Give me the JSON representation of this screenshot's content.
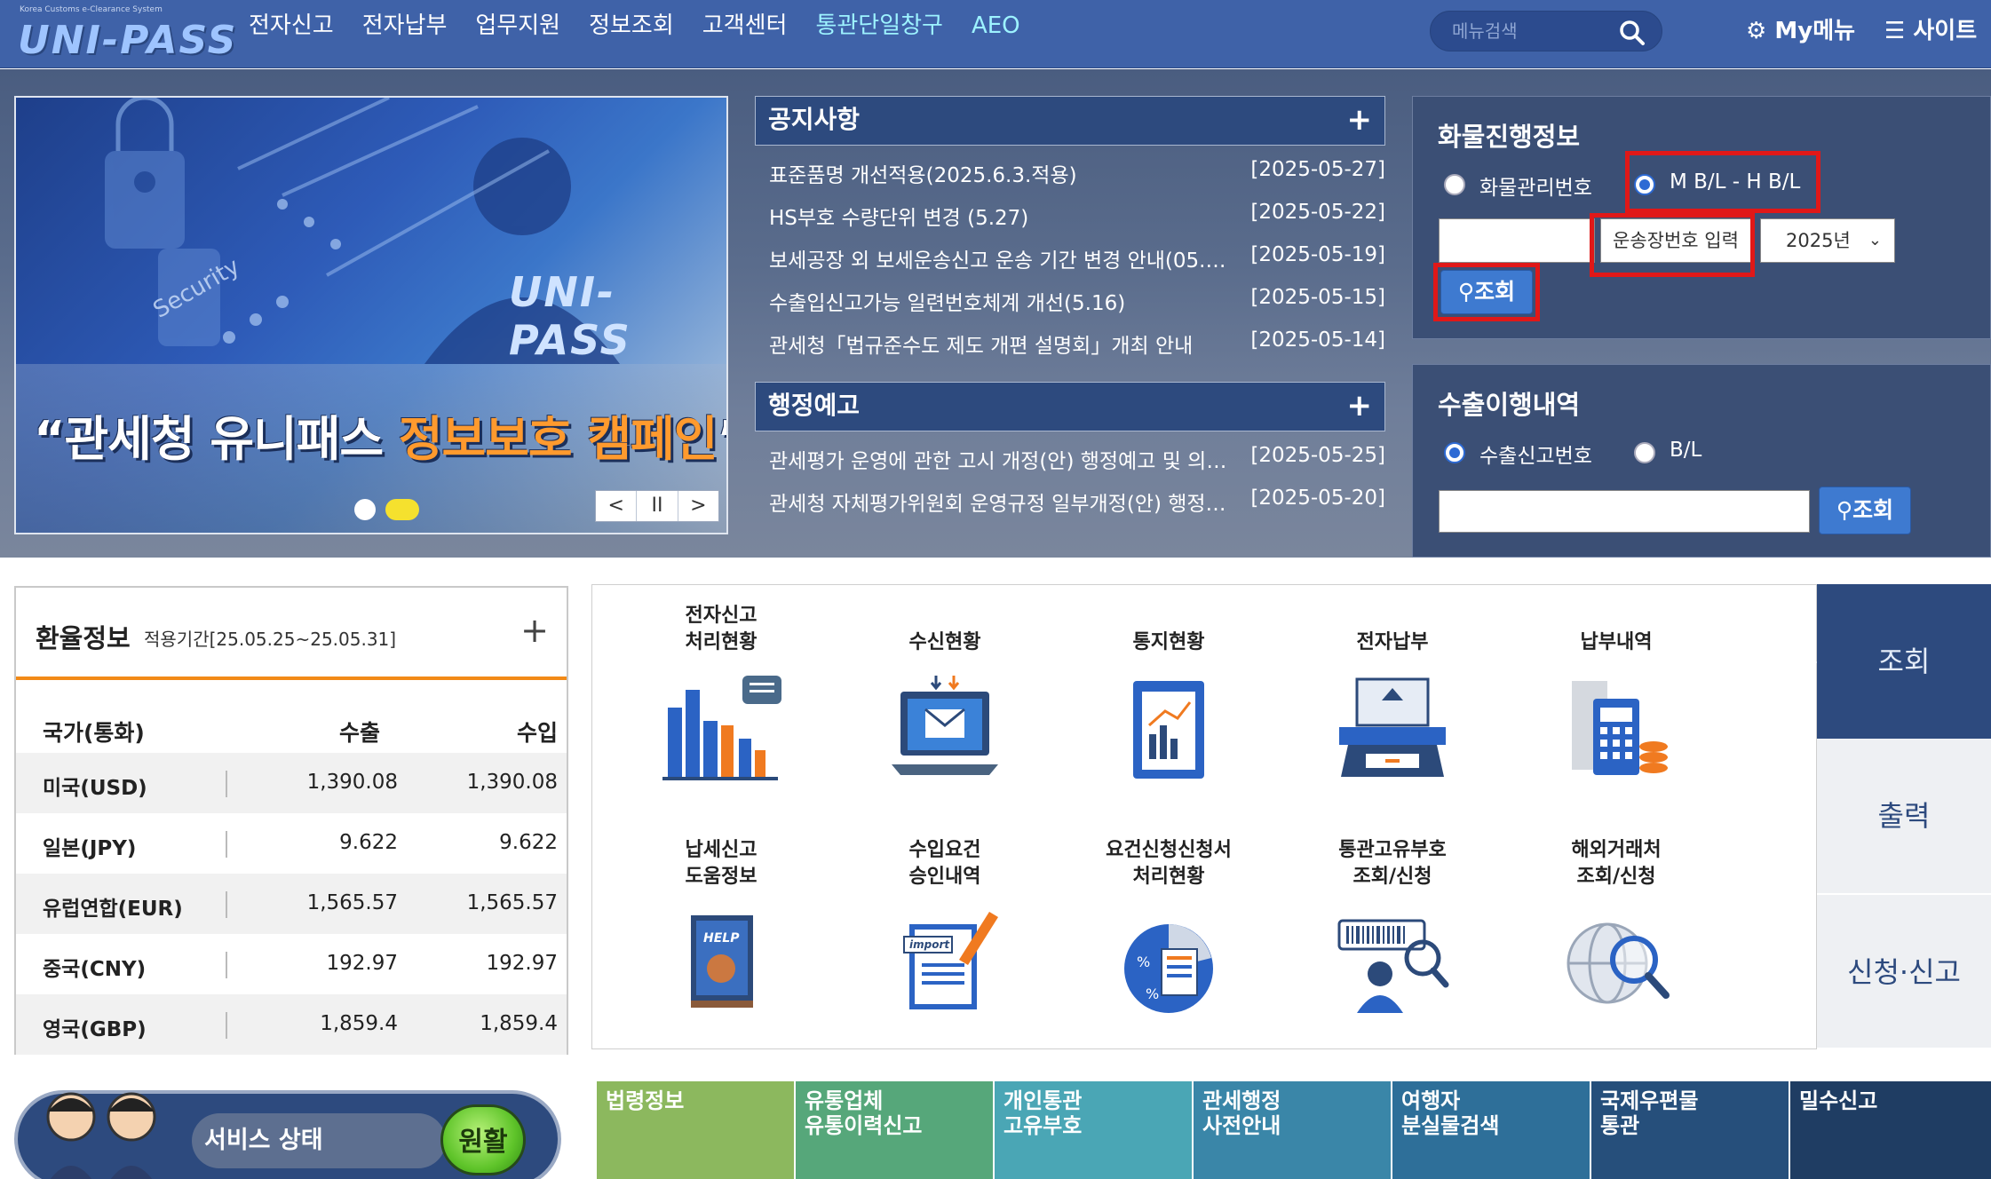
{
  "header": {
    "logo_sub": "Korea Customs e-Clearance System",
    "logo": "UNI-PASS",
    "nav": [
      "전자신고",
      "전자납부",
      "업무지원",
      "정보조회",
      "고객센터",
      "통관단일창구",
      "AEO"
    ],
    "search_placeholder": "메뉴검색",
    "mymenu": "My메뉴",
    "sitemap": "사이트"
  },
  "banner": {
    "title_pre": "“관세청 유니패스 ",
    "title_hl": "정보보호 캠페인",
    "title_post": "”",
    "logo": "UNI-PASS",
    "security_text": "Security",
    "controls": [
      "<",
      "II",
      ">"
    ]
  },
  "notices": {
    "title": "공지사항",
    "plus": "+",
    "items": [
      {
        "title": "표준품명 개선적용(2025.6.3.적용)",
        "date": "[2025-05-27]"
      },
      {
        "title": "HS부호 수량단위 변경 (5.27)",
        "date": "[2025-05-22]"
      },
      {
        "title": "보세공장 외 보세운송신고 운송 기간 변경 안내(05.…",
        "date": "[2025-05-19]"
      },
      {
        "title": "수출입신고가능 일련번호체계 개선(5.16)",
        "date": "[2025-05-15]"
      },
      {
        "title": "관세청「법규준수도 제도 개편 설명회」개최 안내",
        "date": "[2025-05-14]"
      }
    ]
  },
  "admin_notices": {
    "title": "행정예고",
    "plus": "+",
    "items": [
      {
        "title": "관세평가 운영에 관한 고시 개정(안) 행정예고 및 의…",
        "date": "[2025-05-25]"
      },
      {
        "title": "관세청 자체평가위원회 운영규정 일부개정(안) 행정…",
        "date": "[2025-05-20]"
      }
    ]
  },
  "cargo": {
    "title": "화물진행정보",
    "radio1": "화물관리번호",
    "radio2": "M B/L - H B/L",
    "input_label": "운송장번호 입력",
    "year": "2025년",
    "search": "조회"
  },
  "export": {
    "title": "수출이행내역",
    "radio1": "수출신고번호",
    "radio2": "B/L",
    "search": "조회"
  },
  "rates": {
    "title": "환율정보",
    "period": "적용기간[25.05.25~25.05.31]",
    "plus": "+",
    "headers": [
      "국가(통화)",
      "수출",
      "수입"
    ],
    "rows": [
      {
        "country": "미국(USD)",
        "export": "1,390.08",
        "import": "1,390.08"
      },
      {
        "country": "일본(JPY)",
        "export": "9.622",
        "import": "9.622"
      },
      {
        "country": "유럽연합(EUR)",
        "export": "1,565.57",
        "import": "1,565.57"
      },
      {
        "country": "중국(CNY)",
        "export": "192.97",
        "import": "192.97"
      },
      {
        "country": "영국(GBP)",
        "export": "1,859.4",
        "import": "1,859.4"
      }
    ]
  },
  "services": [
    {
      "label": "전자신고\n처리현황",
      "icon": "bar-chart-icon"
    },
    {
      "label": "수신현황",
      "icon": "laptop-mail-icon"
    },
    {
      "label": "통지현황",
      "icon": "clipboard-chart-icon"
    },
    {
      "label": "전자납부",
      "icon": "payment-terminal-icon"
    },
    {
      "label": "납부내역",
      "icon": "calculator-icon"
    },
    {
      "label": "납세신고\n도움정보",
      "icon": "help-book-icon"
    },
    {
      "label": "수입요건\n승인내역",
      "icon": "import-document-icon"
    },
    {
      "label": "요건신청신청서\n처리현황",
      "icon": "percent-chart-icon"
    },
    {
      "label": "통관고유부호\n조회/신청",
      "icon": "barcode-search-icon"
    },
    {
      "label": "해외거래처\n조회/신청",
      "icon": "globe-search-icon"
    }
  ],
  "side_tabs": [
    "조회",
    "출력",
    "신청·신고"
  ],
  "status": {
    "label": "서비스 상태",
    "value": "원활"
  },
  "tiles": [
    {
      "label": "법령정보",
      "color": "#8cb85e"
    },
    {
      "label": "유통업체\n유통이력신고",
      "color": "#56a77a"
    },
    {
      "label": "개인통관\n고유부호",
      "color": "#4aa6b5"
    },
    {
      "label": "관세행정\n사전안내",
      "color": "#3a86a8"
    },
    {
      "label": "여행자\n분실물검색",
      "color": "#2e6f99"
    },
    {
      "label": "국제우편물\n통관",
      "color": "#264f7b"
    },
    {
      "label": "밀수신고",
      "color": "#1f3d63"
    }
  ]
}
